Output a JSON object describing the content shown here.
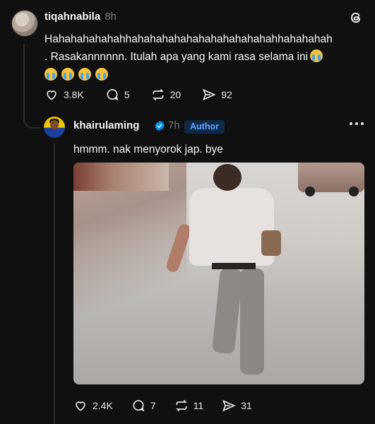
{
  "post": {
    "username": "tiqahnabila",
    "time": "8h",
    "line1": "Hahahahahahahhahahahahahahahahahahahahhahahahah",
    "line2": ". Rasakannnnnn. Itulah apa yang kami rasa selama ini",
    "stats": {
      "likes": "3.8K",
      "replies": "5",
      "reposts": "20",
      "shares": "92"
    }
  },
  "reply": {
    "username": "khairulaming",
    "time": "7h",
    "badge": "Author",
    "text": "hmmm. nak menyorok jap. bye",
    "stats": {
      "likes": "2.4K",
      "replies": "7",
      "reposts": "11",
      "shares": "31"
    }
  },
  "colors": {
    "background": "#101010",
    "accent_badge": "#5fa6ff",
    "verified": "#0095f6"
  },
  "icons": [
    "threads-logo-icon",
    "heart-icon",
    "comment-icon",
    "repost-icon",
    "share-icon",
    "verified-icon",
    "more-icon"
  ]
}
